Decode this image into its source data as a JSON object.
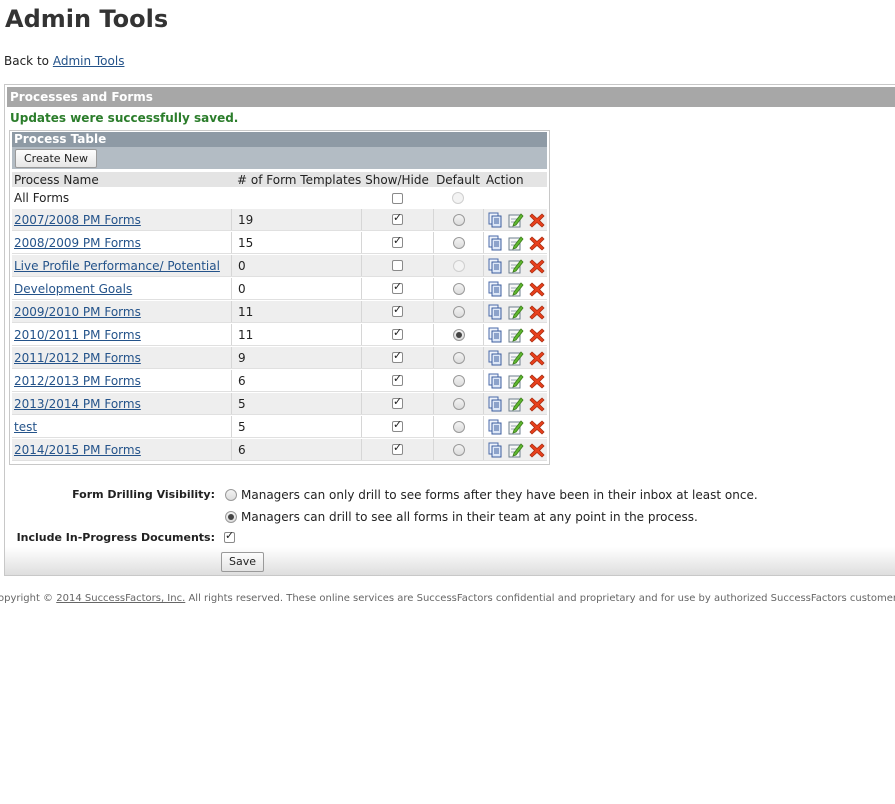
{
  "page": {
    "title": "Admin Tools",
    "back_prefix": "Back to",
    "back_link": "Admin Tools"
  },
  "panel": {
    "header": "Processes and Forms",
    "success_message": "Updates were successfully saved."
  },
  "process_table": {
    "title": "Process Table",
    "create_new_label": "Create New",
    "columns": [
      "Process Name",
      "# of Form Templates",
      "Show/Hide",
      "Default",
      "Action"
    ],
    "all_forms_label": "All Forms",
    "rows": [
      {
        "name": "2007/2008 PM Forms",
        "count": "19",
        "show": true,
        "default": false
      },
      {
        "name": "2008/2009 PM Forms",
        "count": "15",
        "show": true,
        "default": false
      },
      {
        "name": "Live Profile Performance/ Potential",
        "count": "0",
        "show": false,
        "default": false,
        "default_disabled": true
      },
      {
        "name": "Development Goals",
        "count": "0",
        "show": true,
        "default": false
      },
      {
        "name": "2009/2010 PM Forms",
        "count": "11",
        "show": true,
        "default": false
      },
      {
        "name": "2010/2011 PM Forms",
        "count": "11",
        "show": true,
        "default": true
      },
      {
        "name": "2011/2012 PM Forms",
        "count": "9",
        "show": true,
        "default": false
      },
      {
        "name": "2012/2013 PM Forms",
        "count": "6",
        "show": true,
        "default": false
      },
      {
        "name": "2013/2014 PM Forms",
        "count": "5",
        "show": true,
        "default": false
      },
      {
        "name": "test",
        "count": "5",
        "show": true,
        "default": false
      },
      {
        "name": "2014/2015 PM Forms",
        "count": "6",
        "show": true,
        "default": false
      }
    ],
    "action_icons": [
      "copy-icon",
      "edit-icon",
      "delete-icon"
    ]
  },
  "settings": {
    "drilling_label": "Form Drilling Visibility:",
    "drilling_options": [
      {
        "label": "Managers can only drill to see forms after they have been in their inbox at least once.",
        "selected": false
      },
      {
        "label": "Managers can drill to see all forms in their team at any point in the process.",
        "selected": true
      }
    ],
    "in_progress_label": "Include In-Progress Documents:",
    "in_progress_checked": true,
    "save_label": "Save"
  },
  "footer": {
    "prefix": "opyright © ",
    "company_link": "2014 SuccessFactors, Inc.",
    "suffix": " All rights reserved. These online services are SuccessFactors confidential and proprietary and for use by authorized SuccessFactors customers o"
  },
  "colors": {
    "panel_header": "#a7a7a7",
    "table_title": "#8e9aa5",
    "success": "#2b7d2b",
    "link": "#24538a"
  }
}
